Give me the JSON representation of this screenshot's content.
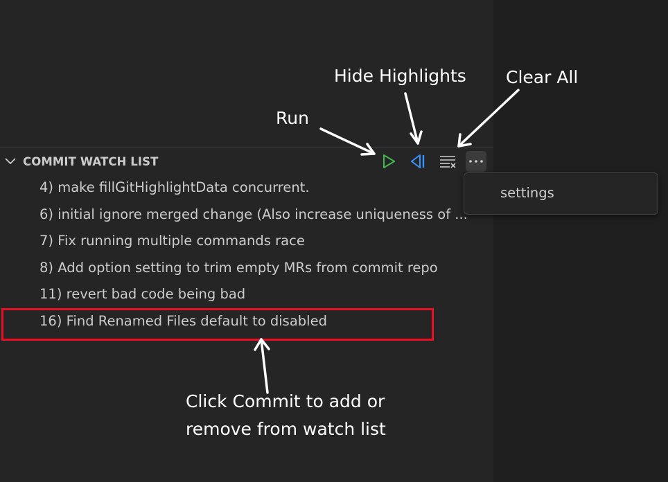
{
  "panel": {
    "section_title": "COMMIT WATCH LIST",
    "toolbar": {
      "run_icon": "play-icon",
      "hide_highlights_icon": "step-back-icon",
      "clear_all_icon": "clear-list-icon",
      "more_icon": "ellipsis-icon"
    },
    "commits": [
      "4) make fillGitHighlightData concurrent.",
      "6) initial ignore merged change (Also increase uniqueness of ...",
      "7) Fix running multiple commands race",
      "8) Add option setting to trim empty MRs from commit repo",
      "11) revert bad code being bad",
      "16) Find Renamed Files default to disabled"
    ]
  },
  "menu": {
    "items": [
      "settings"
    ]
  },
  "annotations": {
    "run": "Run",
    "hide_highlights": "Hide Highlights",
    "clear_all": "Clear All",
    "click_commit_line1": "Click Commit to add or",
    "click_commit_line2": "remove from watch list"
  },
  "colors": {
    "run_icon": "#3fb950",
    "hide_highlights_icon": "#3794ff",
    "highlight_border": "#e81123"
  }
}
